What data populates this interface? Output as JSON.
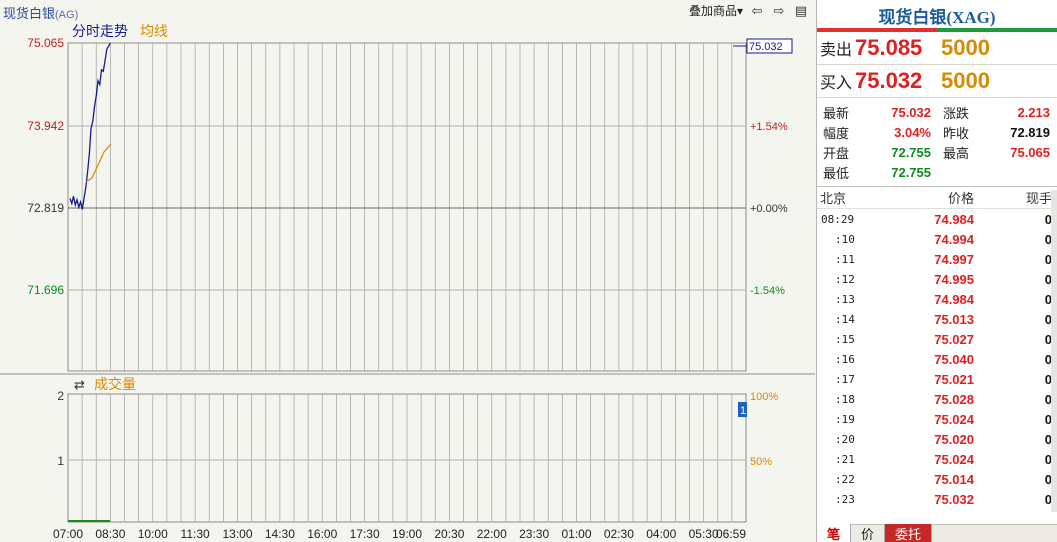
{
  "header": {
    "name": "现货白银",
    "code": "(AG)",
    "overlay_label": "叠加商品",
    "dropdown_glyph": "▾",
    "back_glyph": "⇦",
    "fwd_glyph": "⇨",
    "layout_glyph": "▤"
  },
  "price_chart": {
    "title": "分时走势",
    "avg_label": "均线",
    "y_left": [
      "75.065",
      "73.942",
      "72.819",
      "71.696"
    ],
    "y_right": [
      "+1.54%",
      "+0.00%",
      "-1.54%"
    ],
    "current_price_tag": "75.032"
  },
  "volume_chart": {
    "title": "成交量",
    "toggle_glyph": "⇄",
    "y_left": [
      "2",
      "1"
    ],
    "y_right": [
      "100%",
      "50%"
    ],
    "marker": "1"
  },
  "time_axis": [
    "07:00",
    "08:30",
    "10:00",
    "11:30",
    "13:00",
    "14:30",
    "16:00",
    "17:30",
    "19:00",
    "20:30",
    "22:00",
    "23:30",
    "01:00",
    "02:30",
    "04:00",
    "05:30",
    "06:59"
  ],
  "quote": {
    "title": "现货白银(XAG)",
    "sell_label": "卖出",
    "sell_price": "75.085",
    "sell_volume": "5000",
    "buy_label": "买入",
    "buy_price": "75.032",
    "buy_volume": "5000",
    "stats": {
      "latest_label": "最新",
      "latest": "75.032",
      "change_label": "涨跌",
      "change": "2.213",
      "amplitude_label": "幅度",
      "amplitude": "3.04%",
      "prev_close_label": "昨收",
      "prev_close": "72.819",
      "open_label": "开盘",
      "open": "72.755",
      "high_label": "最高",
      "high": "75.065",
      "low_label": "最低",
      "low": "72.755"
    },
    "ticks_header": {
      "time": "北京",
      "price": "价格",
      "hand": "现手"
    },
    "ticks": [
      {
        "time": "08:29",
        "price": "74.984",
        "hand": "0"
      },
      {
        "time": ":10",
        "price": "74.994",
        "hand": "0"
      },
      {
        "time": ":11",
        "price": "74.997",
        "hand": "0"
      },
      {
        "time": ":12",
        "price": "74.995",
        "hand": "0"
      },
      {
        "time": ":13",
        "price": "74.984",
        "hand": "0"
      },
      {
        "time": ":14",
        "price": "75.013",
        "hand": "0"
      },
      {
        "time": ":15",
        "price": "75.027",
        "hand": "0"
      },
      {
        "time": ":16",
        "price": "75.040",
        "hand": "0"
      },
      {
        "time": ":17",
        "price": "75.021",
        "hand": "0"
      },
      {
        "time": ":18",
        "price": "75.028",
        "hand": "0"
      },
      {
        "time": ":19",
        "price": "75.024",
        "hand": "0"
      },
      {
        "time": ":20",
        "price": "75.020",
        "hand": "0"
      },
      {
        "time": ":21",
        "price": "75.024",
        "hand": "0"
      },
      {
        "time": ":22",
        "price": "75.014",
        "hand": "0"
      },
      {
        "time": ":23",
        "price": "75.032",
        "hand": "0"
      }
    ],
    "tabs": [
      "笔",
      "价",
      "委托"
    ]
  },
  "colors": {
    "up": "#e02020",
    "down": "#0e8a1e",
    "price_line": "#1a1a8c",
    "avg_line": "#d98a00",
    "grid": "#9a9a9a"
  }
}
